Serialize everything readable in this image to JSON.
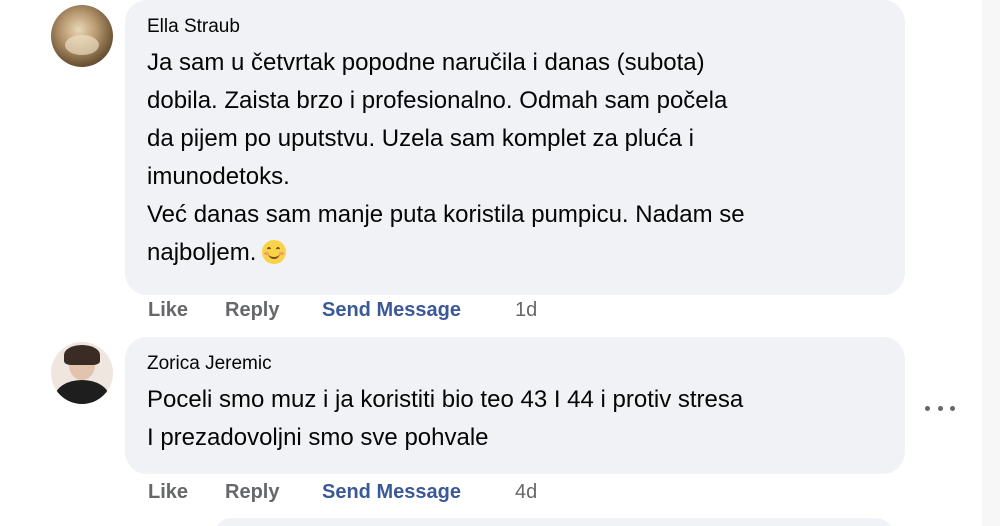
{
  "comments": [
    {
      "author": "Ella Straub",
      "lines": [
        "Ja sam u četvrtak popodne naručila i danas (subota)",
        "dobila. Zaista brzo i profesionalno. Odmah sam počela",
        "da pijem po uputstvu. Uzela sam komplet za pluća i",
        "imunodetoks.",
        "Već danas sam manje puta koristila pumpicu. Nadam se",
        "najboljem."
      ],
      "emoji": "smiling-face-emoji",
      "actions": {
        "like": "Like",
        "reply": "Reply",
        "send_message": "Send Message",
        "time": "1d"
      }
    },
    {
      "author": "Zorica Jeremic",
      "lines": [
        "Poceli smo muz i ja koristiti bio teo 43 I 44 i protiv stresa",
        "I prezadovoljni smo sve pohvale"
      ],
      "actions": {
        "like": "Like",
        "reply": "Reply",
        "send_message": "Send Message",
        "time": "4d"
      }
    }
  ],
  "icons": {
    "more_options": "more-options-icon"
  },
  "colors": {
    "bubble_bg": "#f0f2f5",
    "send_message": "#3b5998",
    "action_gray": "#65676b"
  }
}
